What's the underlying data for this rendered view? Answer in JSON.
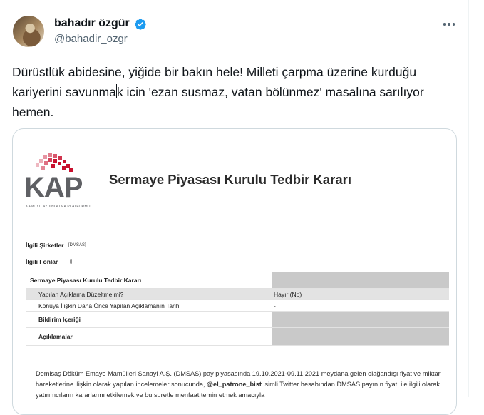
{
  "tweet": {
    "author_name": "bahadır özgür",
    "author_handle": "@bahadir_ozgr",
    "text_before_cursor": "Dürüstlük abidesine, yiğide bir bakın hele! Milleti çarpma üzerine kurduğu kariyerini savunma",
    "text_after_cursor": "k icin 'ezan susmaz, vatan bölünmez' masalına sarılıyor hemen.",
    "verified_icon": "verified-badge-icon",
    "more_icon": "more-options-icon"
  },
  "document": {
    "logo_text": "KAP",
    "logo_subtitle": "KAMUYU AYDINLATMA PLATFORMU",
    "title": "Sermaye Piyasası Kurulu Tedbir Kararı",
    "companies_label": "İlgili Şirketler",
    "companies_value": "[DMSAS]",
    "funds_label": "İlgili Fonlar",
    "funds_value": "[]",
    "table": {
      "header": "Sermaye Piyasası Kurulu Tedbir Kararı",
      "rows": [
        {
          "label": "Yapılan Açıklama Düzeltme mi?",
          "value": "Hayır (No)"
        },
        {
          "label": "Konuya İlişkin Daha Önce Yapılan Açıklamanın Tarihi",
          "value": "-"
        },
        {
          "label": "Bildirim İçeriği",
          "value": ""
        },
        {
          "label": "Açıklamalar",
          "value": ""
        }
      ]
    },
    "paragraph_1": "Demisaş Döküm Emaye Mamülleri Sanayi A.Ş. (DMSAS) pay piyasasında 19.10.2021-09.11.2021 meydana gelen olağandışı fiyat ve miktar hareketlerine ilişkin olarak yapılan incelemeler sonucunda, ",
    "paragraph_bold": "@el_patrone_bist",
    "paragraph_2": " isimli Twitter hesabından DMSAS payının fiyatı ile ilgili olarak yatırımcıların kararlarını etkilemek ve bu suretle menfaat temin etmek amacıyla"
  },
  "colors": {
    "kap_red": "#c8102e",
    "kap_gray": "#5f6064",
    "verified_blue": "#1d9bf0",
    "table_gray": "#c9c9c9"
  }
}
